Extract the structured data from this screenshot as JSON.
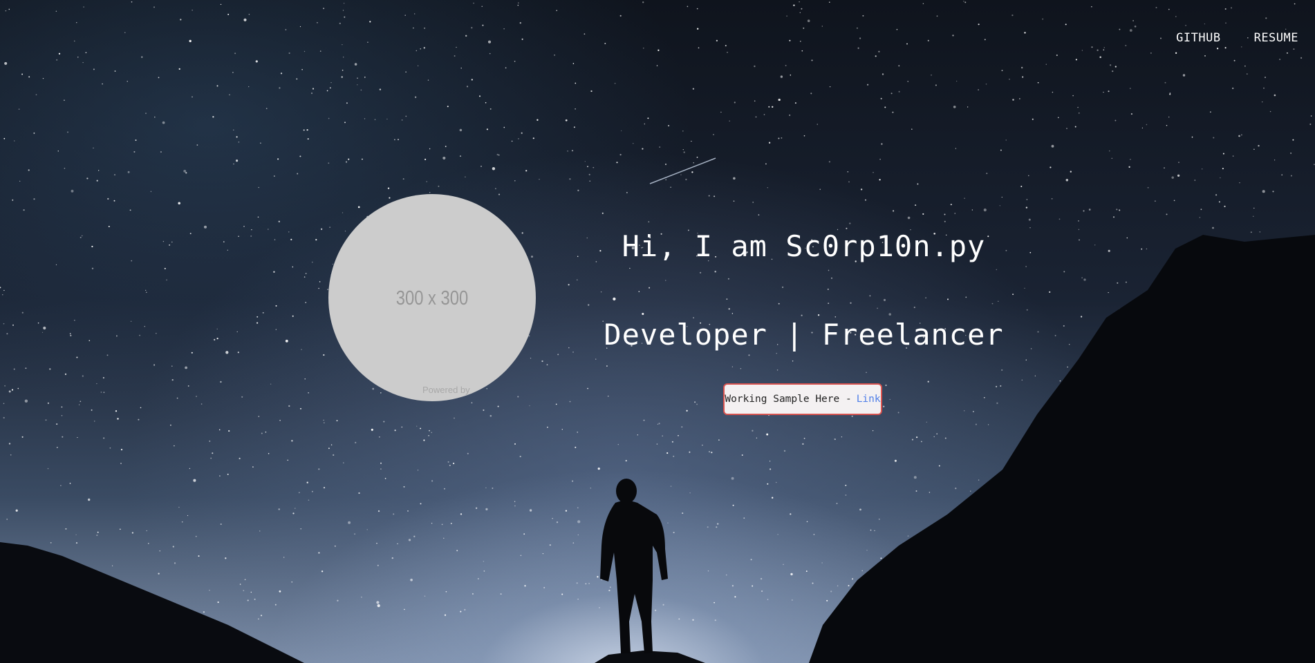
{
  "nav": {
    "github_label": "GITHUB",
    "resume_label": "RESUME"
  },
  "avatar": {
    "placeholder_text": "300 x 300",
    "credit_text": "Powered by"
  },
  "hero": {
    "title": "Hi, I am Sc0rp10n.py",
    "subtitle": "Developer | Freelancer",
    "sample_text": "Working Sample Here -",
    "sample_link_label": "Link"
  },
  "colors": {
    "box_border": "#d9534f",
    "link": "#4f7fe8",
    "avatar_bg": "#cccccc"
  }
}
